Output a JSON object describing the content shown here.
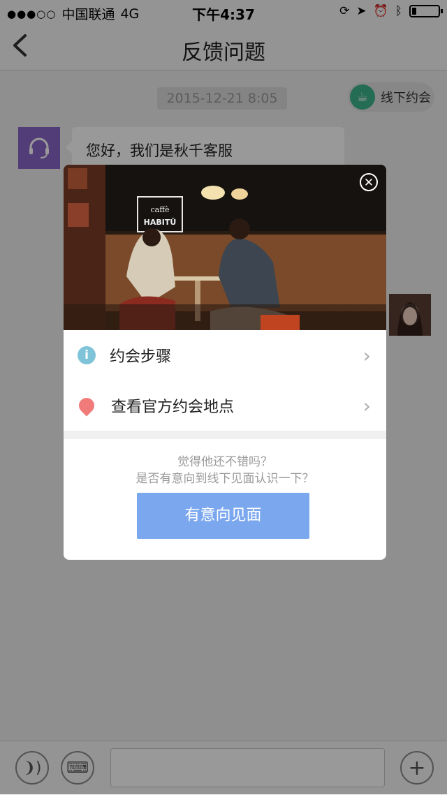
{
  "status_bar": {
    "carrier": "中国联通",
    "network": "4G",
    "time": "下午4:37",
    "battery_level": 0.18
  },
  "nav": {
    "back_icon": "chevron-left-icon",
    "title": "反馈问题"
  },
  "chat": {
    "timestamp": "2015-12-21   8:05",
    "offline_date_button": "线下约会",
    "messages": [
      {
        "sender": "customer-service",
        "text": "您好，我们是秋千客服"
      }
    ]
  },
  "modal": {
    "photo_sign": "caffè HABITŪ",
    "rows": [
      {
        "icon": "info-icon",
        "label": "约会步骤"
      },
      {
        "icon": "location-pin-icon",
        "label": "查看官方约会地点"
      }
    ],
    "prompt_line1": "觉得他还不错吗？",
    "prompt_line2": "是否有意向到线下见面认识一下？",
    "primary_button": "有意向见面"
  },
  "colors": {
    "accent_blue": "#7aa7ee",
    "green_icon": "#3db58a",
    "cs_avatar": "#8b66c9",
    "pin_red": "#f17a7a",
    "info_blue": "#7fc3d9"
  }
}
